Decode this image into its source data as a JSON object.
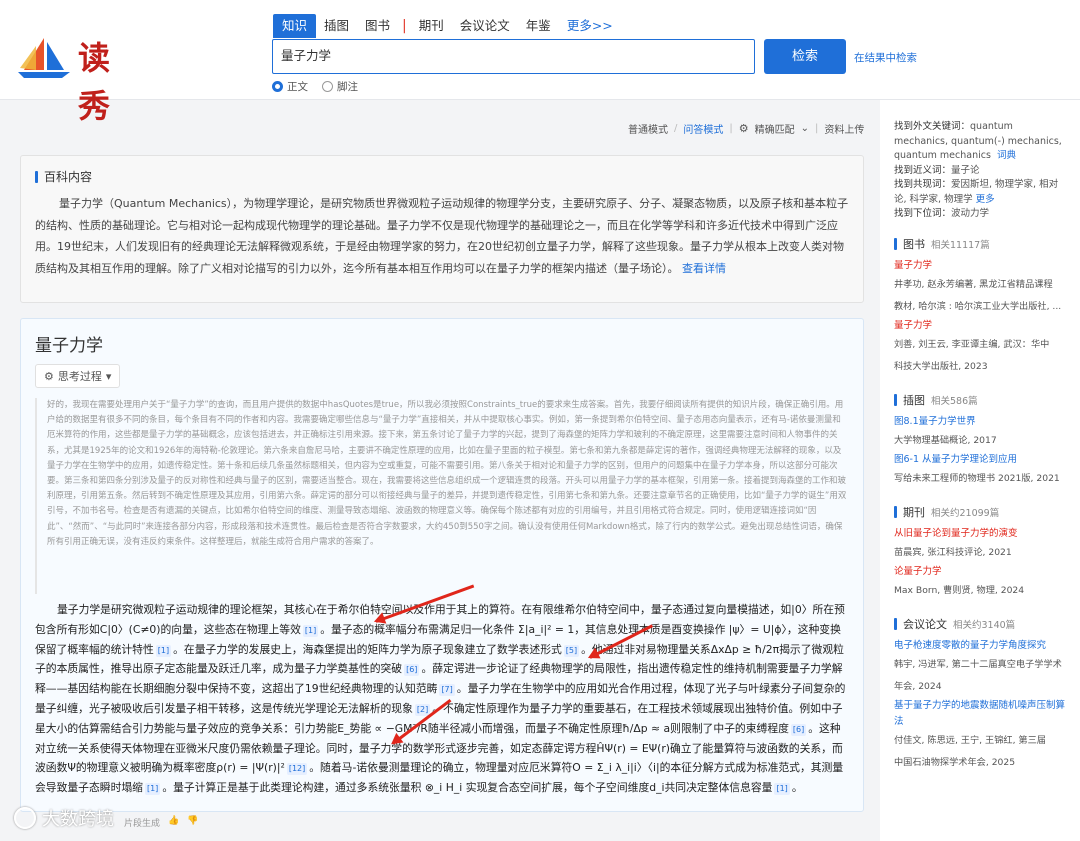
{
  "header": {
    "logo_text": "读秀",
    "tabs": [
      "知识",
      "插图",
      "图书",
      "期刊",
      "会议论文",
      "年鉴"
    ],
    "tab_more": "更多>>",
    "search_value": "量子力学",
    "search_button": "检索",
    "within_link": "在结果中检索",
    "radio_options": [
      "正文",
      "脚注"
    ]
  },
  "modebar": {
    "normal": "普通模式",
    "qa": "问答模式",
    "match": "精确匹配",
    "upload": "资料上传"
  },
  "baike": {
    "title": "百科内容",
    "body": "量子力学（Quantum Mechanics），为物理学理论，是研究物质世界微观粒子运动规律的物理学分支，主要研究原子、分子、凝聚态物质，以及原子核和基本粒子的结构、性质的基础理论。它与相对论一起构成现代物理学的理论基础。量子力学不仅是现代物理学的基础理论之一，而且在化学等学科和许多近代技术中得到广泛应用。19世纪末，人们发现旧有的经典理论无法解释微观系统，于是经由物理学家的努力，在20世纪初创立量子力学，解释了这些现象。量子力学从根本上改变人类对物质结构及其相互作用的理解。除了广义相对论描写的引力以外，迄今所有基本相互作用均可以在量子力学的框架内描述（量子场论）。",
    "more": "查看详情"
  },
  "ai": {
    "title": "量子力学",
    "think_label": "思考过程",
    "think_text": "好的，我现在需要处理用户关于“量子力学”的查询，而且用户提供的数据中hasQuotes是true，所以我必须按照Constraints_true的要求来生成答案。首先，我要仔细阅读所有提供的知识片段，确保正确引用。用户给的数据里有很多不同的条目，每个条目有不同的作者和内容。我需要确定哪些信息与“量子力学”直接相关，并从中提取核心事实。例如，第一条提到希尔伯特空间、量子态用态向量表示，还有马-诺依曼测量和厄米算符的作用，这些都是量子力学的基础概念，应该包括进去，并正确标注引用来源。接下来，第五条讨论了量子力学的兴起，提到了海森堡的矩阵力学和玻利的不确定原理，这里需要注意时间和人物事件的关系，尤其是1925年的论文和1926年的海特勒-伦敦理论。第六条来自詹尼马哈，主要讲不确定性原理的应用，比如在量子里面的粒子模型。第七条和第九条都是薛定谔的著作，强调经典物理无法解释的现象，以及量子力学在生物学中的应用，如遗传稳定性。第十条和后续几条虽然标题相关，但内容为空或重复，可能不需要引用。第八条关于相对论和量子力学的区别，但用户的问题集中在量子力学本身，所以这部分可能次要。第三条和第四条分别涉及量子的反对称性和经典与量子的区别，需要适当整合。现在，我需要将这些信息组织成一个逻辑连贯的段落。开头可以用量子力学的基本框架，引用第一条。接着提到海森堡的工作和玻利原理，引用第五条。然后转到不确定性原理及其应用，引用第六条。薛定谔的部分可以衔接经典与量子的差异，并提到遗传稳定性，引用第七条和第九条。还要注意章节名的正确使用，比如“量子力学的诞生”用双引号，不加书名号。检查是否有遗漏的关键点，比如希尔伯特空间的维度、测量导致态塌缩、波函数的物理意义等。确保每个陈述都有对应的引用编号，并且引用格式符合规定。同时，使用逻辑连接词如“因此”、“然而”、“与此同时”来连接各部分内容，形成段落和技术连贯性。最后检查是否符合字数要求，大约450到550字之间。确认没有使用任何Markdown格式，除了行内的数学公式。避免出现总结性词语，确保所有引用正确无误，没有违反约束条件。这样整理后，就能生成符合用户需求的答案了。",
    "answer": "量子力学是研究微观粒子运动规律的理论框架，其核心在于希尔伯特空间以及作用于其上的算符。在有限维希尔伯特空间中，量子态通过复向量模描述，如|0〉所在预包含所有形如C|0〉(C≠0)的向量，这些态在物理上等效",
    "answer_formula_1": "。量子态的概率幅分布需满足归一化条件 Σ|a_i|² = 1，其信息处理本质是酉变换操作 |ψ〉= U|ϕ〉，这种变换保留了概率幅的统计特性",
    "answer_2": "。在量子力学的发展史上，海森堡提出的矩阵力学为原子现象建立了数学表述形式",
    "answer_3": "。他通过非对易物理量关系ΔxΔp ≥ ħ/2π揭示了微观粒子的本质属性，推导出原子定态能量及跃迁几率，成为量子力学奠基性的突破",
    "answer_4": "。薛定谔进一步论证了经典物理学的局限性，指出遗传稳定性的维持机制需要量子力学解释——基因结构能在长期细胞分裂中保持不变，这超出了19世纪经典物理的认知范畴",
    "answer_5": "。量子力学在生物学中的应用如光合作用过程，体现了光子与叶绿素分子间复杂的量子纠缠，光子被吸收后引发量子相干转移，这是传统光学理论无法解析的现象",
    "answer_6": "。不确定性原理作为量子力学的重要基石，在工程技术领域展现出独特价值。例如中子星大小的估算需结合引力势能与量子效应的竞争关系：引力势能E_势能 ∝ −GM²/R随半径减小而增强，而量子不确定性原理ħ/Δp ≈ a则限制了中子的束缚程度",
    "answer_7": "。这种对立统一关系使得天体物理在亚微米尺度仍需依赖量子理论。同时，量子力学的数学形式逐步完善，如定态薛定谔方程ĤΨ(r) = EΨ(r)确立了能量算符与波函数的关系，而波函数Ψ的物理意义被明确为概率密度ρ(r) = |Ψ(r)|²",
    "answer_8": "。随着马-诺依曼测量理论的确立，物理量对应厄米算符O = Σ_i λ_i|i〉〈i|的本征分解方式成为标准范式，其测量会导致量子态瞬时塌缩",
    "answer_9": "。量子计算正是基于此类理论构建，通过多系统张量积 ⊗_i H_i 实现复合态空间扩展，每个子空间维度d_i共同决定整体信息容量",
    "cites": [
      "[1]",
      "[1]",
      "[1]",
      "[5]",
      "[6]",
      "[7]",
      "[2]",
      "[6]",
      "[12]",
      "[1]",
      "[1]"
    ],
    "footer": "片段生成"
  },
  "watermark": "大数跨境",
  "sidebar": {
    "related": [
      {
        "label": "找到外文关键词：",
        "value": "quantum mechanics, quantum(-) mechanics, quantum mechanics",
        "link": "词典"
      },
      {
        "label": "找到近义词：",
        "value": "量子论"
      },
      {
        "label": "找到共现词：",
        "value": "爱因斯坦, 物理学家, 相对论, 科学家, 物理学",
        "link": "更多"
      },
      {
        "label": "找到下位词：",
        "value": "波动力学"
      }
    ],
    "sections": [
      {
        "title": "图书",
        "count": "相关11117篇",
        "items": [
          {
            "title": "量子力学",
            "meta": [
              "井孝功, 赵永芳编著, 黑龙江省精品课程",
              "教材, 哈尔滨 : 哈尔滨工业大学出版社, ..."
            ]
          },
          {
            "title": "量子力学",
            "meta": [
              "刘善, 刘王云, 李亚谭主编, 武汉：华中",
              "科技大学出版社, 2023"
            ]
          }
        ]
      },
      {
        "title": "插图",
        "count": "相关586篇",
        "items": [
          {
            "title": "图8.1量子力学世界",
            "meta": [
              "大学物理基础概论, 2017"
            ],
            "blue": true
          },
          {
            "title": "图6-1 从量子力学理论到应用",
            "meta": [
              "写给未来工程师的物理书 2021版, 2021"
            ],
            "blue": true
          }
        ]
      },
      {
        "title": "期刊",
        "count": "相关约21099篇",
        "items": [
          {
            "title": "从旧量子论到量子力学的演变",
            "meta": [
              "苗晨宾, 张江科技评论, 2021"
            ]
          },
          {
            "title": "论量子力学",
            "meta": [
              "Max Born, 曹则贤, 物理, 2024"
            ]
          }
        ]
      },
      {
        "title": "会议论文",
        "count": "相关约3140篇",
        "items": [
          {
            "title": "电子枪速度零散的量子力学角度探究",
            "meta": [
              "韩宇, 冯进军, 第二十二届真空电子学学术年会, 2024"
            ],
            "blue": true
          },
          {
            "title": "基于量子力学的地震数据随机噪声压制算法",
            "meta": [
              "付佳文, 陈思远, 王宁, 王锦红, 第三届",
              "中国石油物探学术年会, 2025"
            ],
            "blue": true
          }
        ]
      }
    ]
  }
}
